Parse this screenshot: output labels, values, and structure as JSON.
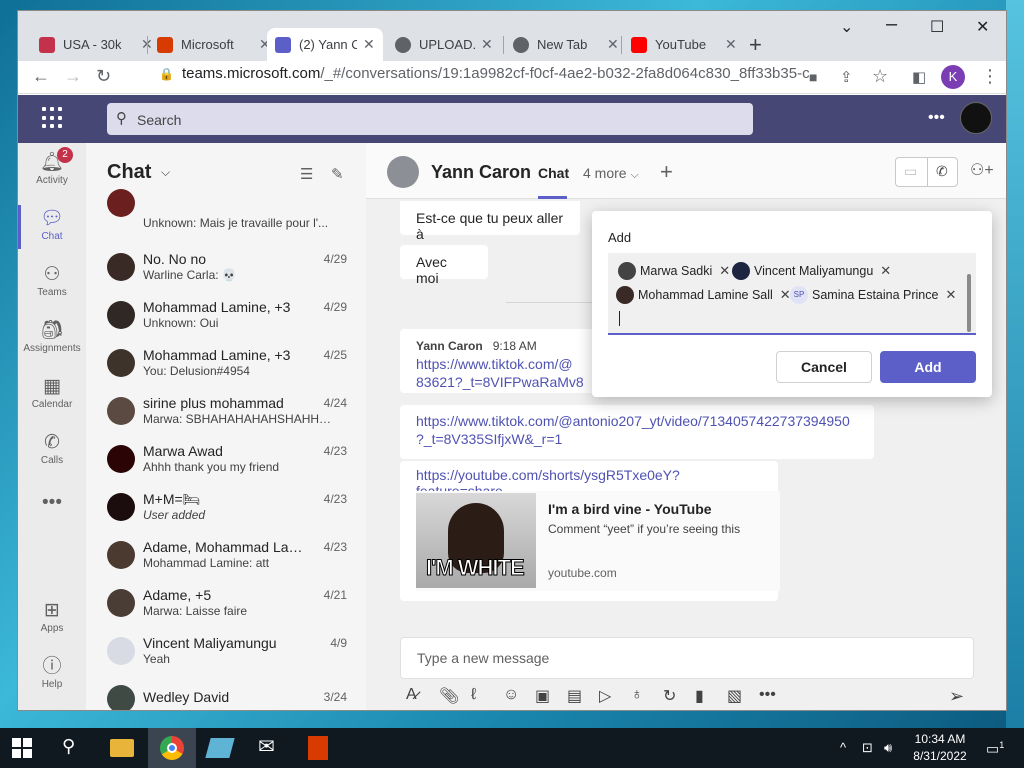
{
  "browser": {
    "tabs": [
      {
        "label": "USA - 30k",
        "color": "#c4314b"
      },
      {
        "label": "Microsoft",
        "color": "#d83b01"
      },
      {
        "label": "(2) Yann C",
        "color": "#5b5fc7"
      },
      {
        "label": "UPLOAD.E",
        "color": "#5f6368"
      },
      {
        "label": "New Tab",
        "color": "#5f6368"
      },
      {
        "label": "YouTube",
        "color": "#ff0000"
      }
    ],
    "url_main": "teams.microsoft.com",
    "url_rest": "/_#/conversations/19:1a9982cf-f0cf-4ae2-b032-2fa8d064c830_8ff33b35-cbe3-46...",
    "profile_initial": "K"
  },
  "teams": {
    "search_placeholder": "Search",
    "rail": [
      {
        "label": "Activity",
        "icon": "bell-icon",
        "badge": "2"
      },
      {
        "label": "Chat",
        "icon": "chat-icon"
      },
      {
        "label": "Teams",
        "icon": "teams-icon"
      },
      {
        "label": "Assignments",
        "icon": "assignments-icon"
      },
      {
        "label": "Calendar",
        "icon": "calendar-icon"
      },
      {
        "label": "Calls",
        "icon": "phone-icon"
      },
      {
        "label": "Apps",
        "icon": "apps-icon"
      },
      {
        "label": "Help",
        "icon": "help-icon"
      }
    ],
    "chat_list": {
      "title": "Chat",
      "items": [
        {
          "name": "",
          "preview": "Unknown: Mais je travaille pour l'...",
          "date": ""
        },
        {
          "name": "No. No no",
          "preview": "Warline Carla: 💀",
          "date": "4/29"
        },
        {
          "name": "Mohammad Lamine, +3",
          "preview": "Unknown: Oui",
          "date": "4/29"
        },
        {
          "name": "Mohammad Lamine, +3",
          "preview": "You: Delusion#4954",
          "date": "4/25"
        },
        {
          "name": "sirine plus mohammad",
          "preview": "Marwa: SBHAHAHAHAHSHAHHA...",
          "date": "4/24"
        },
        {
          "name": "Marwa Awad",
          "preview": "Ahhh thank you my friend",
          "date": "4/23"
        },
        {
          "name": "M+M=🛏",
          "preview": "User added",
          "date": "4/23"
        },
        {
          "name": "Adame, Mohammad Lami...",
          "preview": "Mohammad Lamine: att",
          "date": "4/23"
        },
        {
          "name": "Adame, +5",
          "preview": "Marwa: Laisse faire",
          "date": "4/21"
        },
        {
          "name": "Vincent Maliyamungu",
          "preview": "Yeah",
          "date": "4/9"
        },
        {
          "name": "Wedley David",
          "preview": "",
          "date": "3/24"
        }
      ]
    },
    "conversation": {
      "name": "Yann Caron",
      "tab_chat": "Chat",
      "tab_more": "4 more",
      "msg1": "Est-ce que tu peux aller à",
      "msg2": "Avec moi",
      "sender": "Yann Caron",
      "time": "9:18 AM",
      "link1a": "https://www.tiktok.com/@",
      "link1b": "83621?_t=8VIFPwaRaMv8",
      "link2a": "https://www.tiktok.com/@antonio207_yt/video/7134057422737394950",
      "link2b": "?_t=8V335SIfjxW&_r=1",
      "link3": "https://youtube.com/shorts/ysgR5Txe0eY?feature=share",
      "card_title": "I'm a bird vine - YouTube",
      "card_desc": "Comment “yeet” if you’re seeing this",
      "card_domain": "youtube.com",
      "thumb_caption": "I'M WHITE",
      "compose_placeholder": "Type a new message"
    },
    "add_popup": {
      "title": "Add",
      "chips": [
        {
          "name": "Marwa Sadki"
        },
        {
          "name": "Vincent Maliyamungu"
        },
        {
          "name": "Mohammad Lamine Sall"
        },
        {
          "name": "Samina Estaina Prince",
          "initials": "SP"
        }
      ],
      "cancel_label": "Cancel",
      "add_label": "Add"
    }
  },
  "taskbar": {
    "time": "10:34 AM",
    "date": "8/31/2022",
    "notif_count": "1"
  }
}
